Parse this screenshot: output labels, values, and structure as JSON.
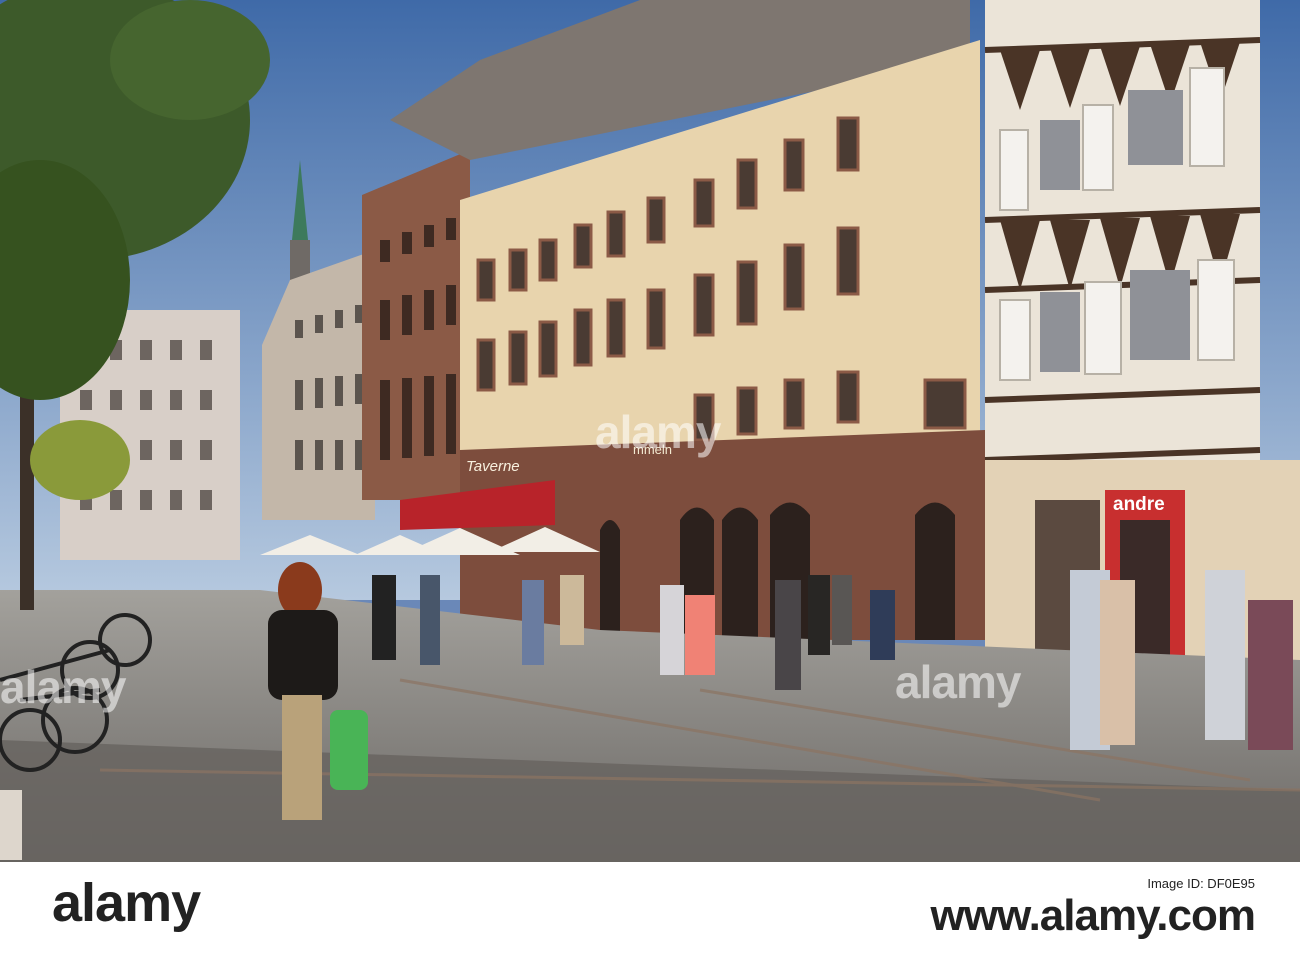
{
  "photo": {
    "watermark": "alamy",
    "signs": {
      "shop": "andre",
      "restaurant": "Taverne",
      "store": "mmeln"
    }
  },
  "footer": {
    "brand": "alamy",
    "caption": "Image ID: DF0E95",
    "image_id": "www.alamy.com"
  },
  "colors": {
    "sky": "#6a88b8",
    "facade": "#e8d4ad",
    "sandstone": "#8b5a46",
    "awning": "#b8232a",
    "ground": "#8d8a86"
  }
}
